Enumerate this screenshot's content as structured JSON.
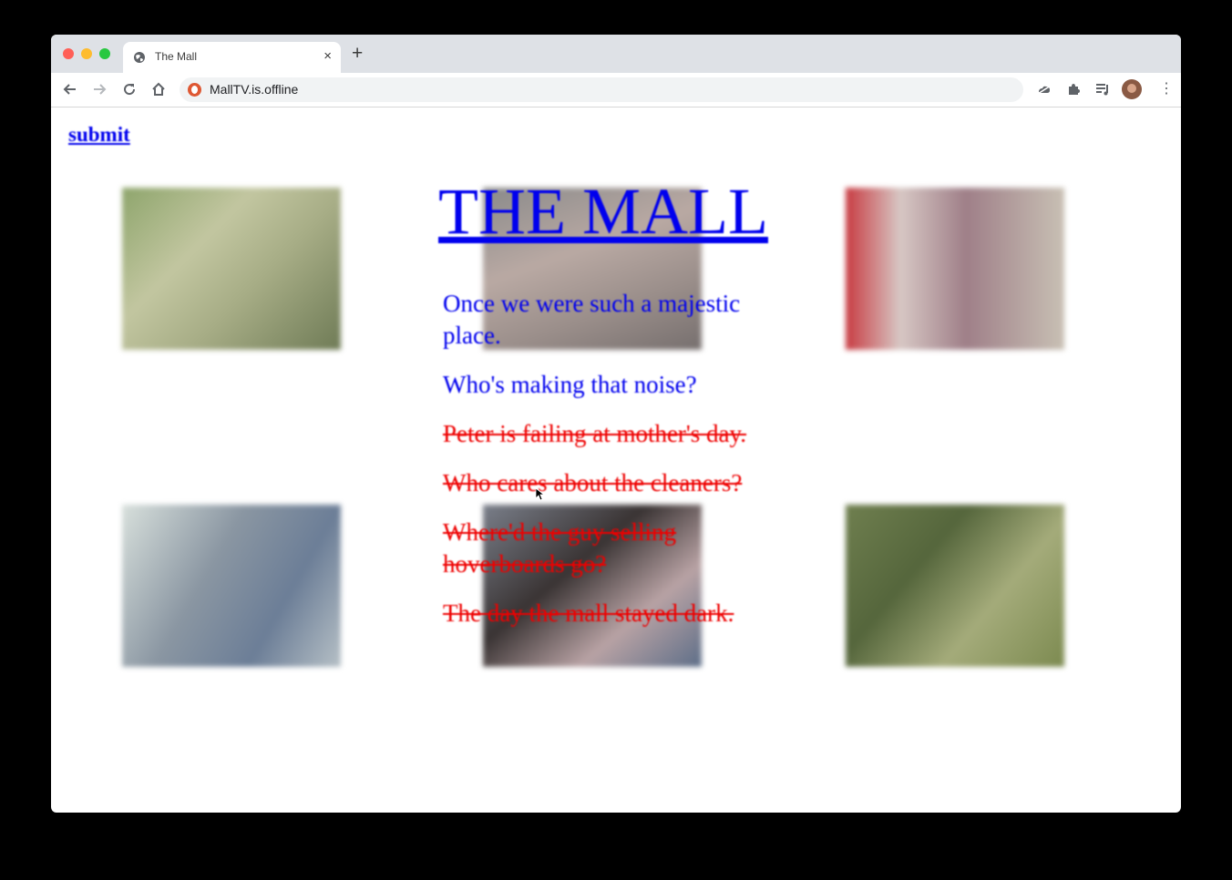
{
  "browser": {
    "tab_title": "The Mall",
    "tab_close": "×",
    "new_tab": "+",
    "url": "MallTV.is.offline"
  },
  "page": {
    "submit_link": "submit",
    "title": "THE MALL",
    "lines": [
      {
        "text": "Once we were such a majestic place.",
        "state": "active"
      },
      {
        "text": "Who's making that noise?",
        "state": "active"
      },
      {
        "text": "Peter is failing at mother's day.",
        "state": "struck"
      },
      {
        "text": "Who cares about the cleaners?",
        "state": "struck"
      },
      {
        "text": "Where'd the guy selling hoverboards go?",
        "state": "struck"
      },
      {
        "text": "The day the mall stayed dark.",
        "state": "struck"
      }
    ]
  },
  "colors": {
    "link_blue": "#0000ee",
    "strike_red": "#ee0000"
  }
}
